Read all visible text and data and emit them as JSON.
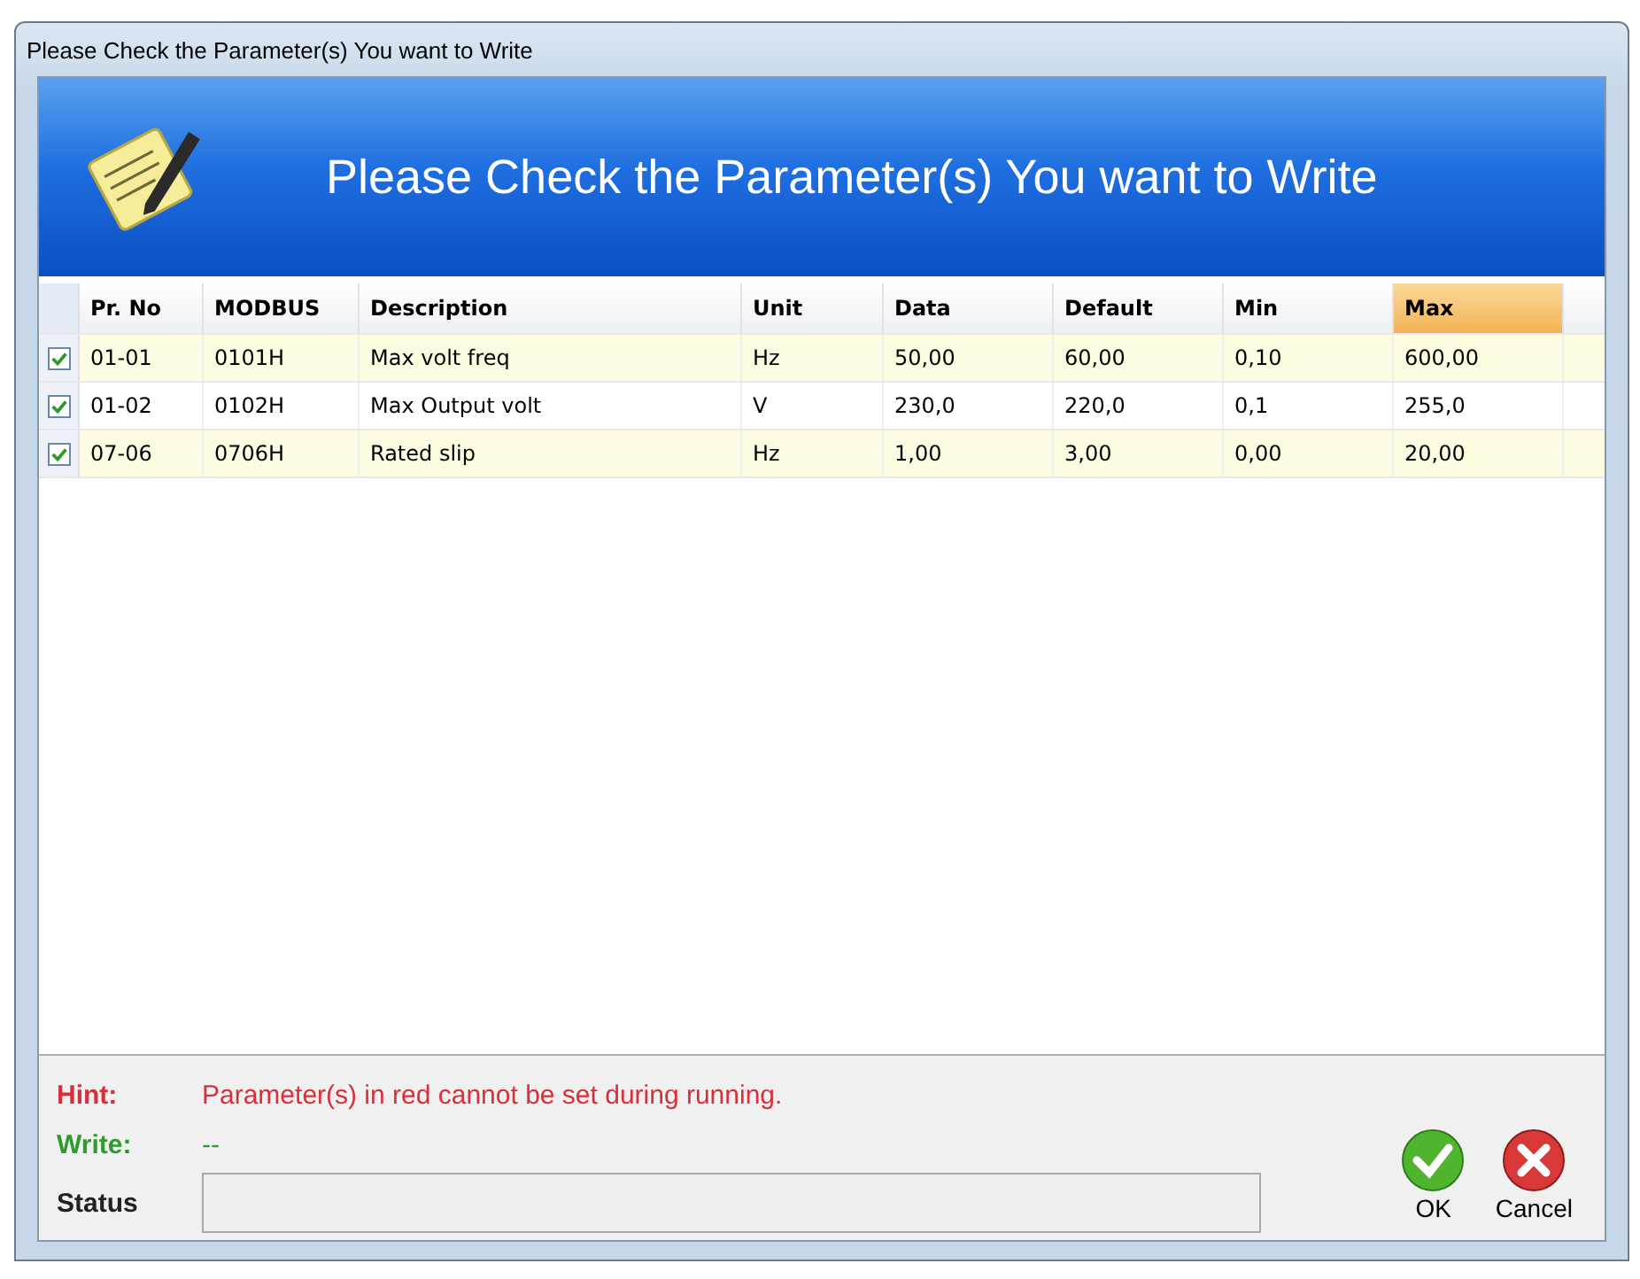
{
  "window": {
    "title": "Please Check the Parameter(s) You want to Write"
  },
  "banner": {
    "title": "Please Check the Parameter(s) You want to Write"
  },
  "table": {
    "columns": [
      {
        "label": "Pr. No",
        "selected": false
      },
      {
        "label": "MODBUS",
        "selected": false
      },
      {
        "label": "Description",
        "selected": false
      },
      {
        "label": "Unit",
        "selected": false
      },
      {
        "label": "Data",
        "selected": false
      },
      {
        "label": "Default",
        "selected": false
      },
      {
        "label": "Min",
        "selected": false
      },
      {
        "label": "Max",
        "selected": true
      }
    ],
    "rows": [
      {
        "checked": true,
        "cells": [
          "01-01",
          "0101H",
          "Max volt freq",
          "Hz",
          "50,00",
          "60,00",
          "0,10",
          "600,00"
        ]
      },
      {
        "checked": true,
        "cells": [
          "01-02",
          "0102H",
          "Max Output volt",
          "V",
          "230,0",
          "220,0",
          "0,1",
          "255,0"
        ]
      },
      {
        "checked": true,
        "cells": [
          "07-06",
          "0706H",
          "Rated slip",
          "Hz",
          "1,00",
          "3,00",
          "0,00",
          "20,00"
        ]
      }
    ]
  },
  "hint": {
    "label": "Hint:",
    "text": "Parameter(s) in red cannot be set during running."
  },
  "write": {
    "label": "Write:",
    "text": "--"
  },
  "status": {
    "label": "Status"
  },
  "buttons": [
    {
      "kind": "ok",
      "label": "OK"
    },
    {
      "kind": "cancel",
      "label": "Cancel"
    }
  ]
}
